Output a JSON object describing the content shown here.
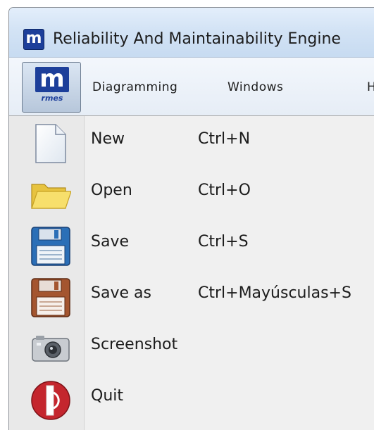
{
  "window": {
    "title": "Reliability And Maintainability Engine",
    "logo_letter": "m"
  },
  "menubar": {
    "app_logo_letter": "m",
    "app_logo_sub": "rmes",
    "items": [
      {
        "label": "Diagramming"
      },
      {
        "label": "Windows"
      },
      {
        "label": "H"
      }
    ]
  },
  "file_menu": {
    "items": [
      {
        "label": "New",
        "shortcut": "Ctrl+N",
        "icon": "new-document-icon"
      },
      {
        "label": "Open",
        "shortcut": "Ctrl+O",
        "icon": "folder-icon"
      },
      {
        "label": "Save",
        "shortcut": "Ctrl+S",
        "icon": "floppy-disk-icon"
      },
      {
        "label": "Save as",
        "shortcut": "Ctrl+Mayúsculas+S",
        "icon": "floppy-disk-save-as-icon"
      },
      {
        "label": "Screenshot",
        "shortcut": "",
        "icon": "camera-icon"
      },
      {
        "label": "Quit",
        "shortcut": "",
        "icon": "quit-icon"
      }
    ]
  },
  "colors": {
    "brand_blue": "#1d3f9a",
    "save_blue": "#2b6fb7",
    "save_as_brown": "#a4552f",
    "quit_red": "#c4262e"
  }
}
